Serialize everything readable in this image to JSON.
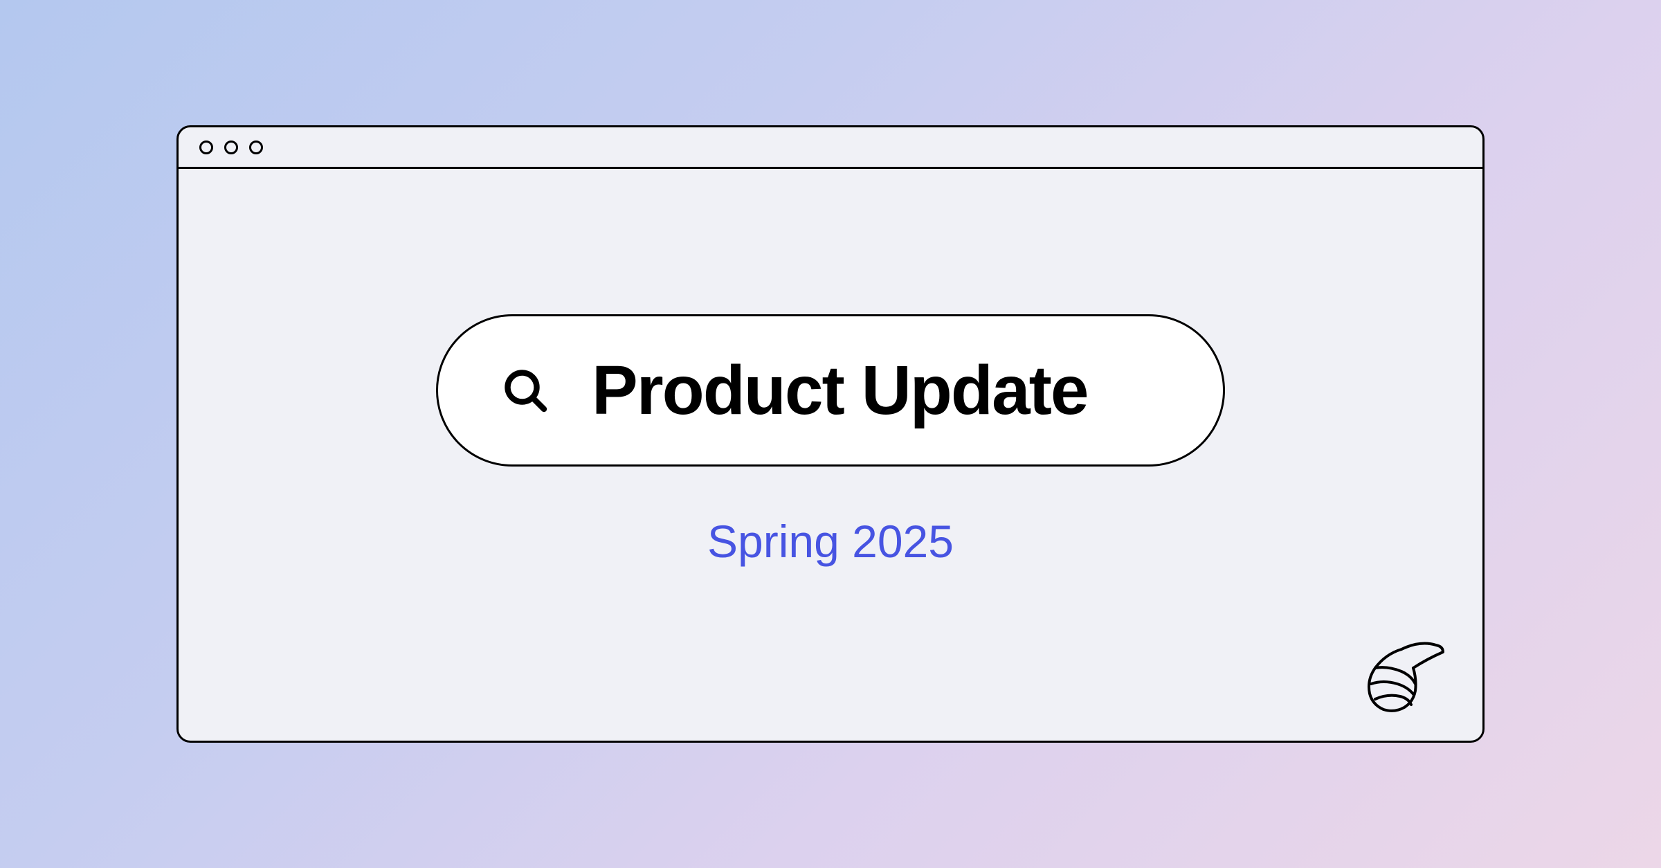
{
  "searchBox": {
    "text": "Product Update"
  },
  "subtitle": "Spring 2025",
  "colors": {
    "subtitle": "#4754e2",
    "windowBg": "#f0f1f6",
    "border": "#000000"
  }
}
